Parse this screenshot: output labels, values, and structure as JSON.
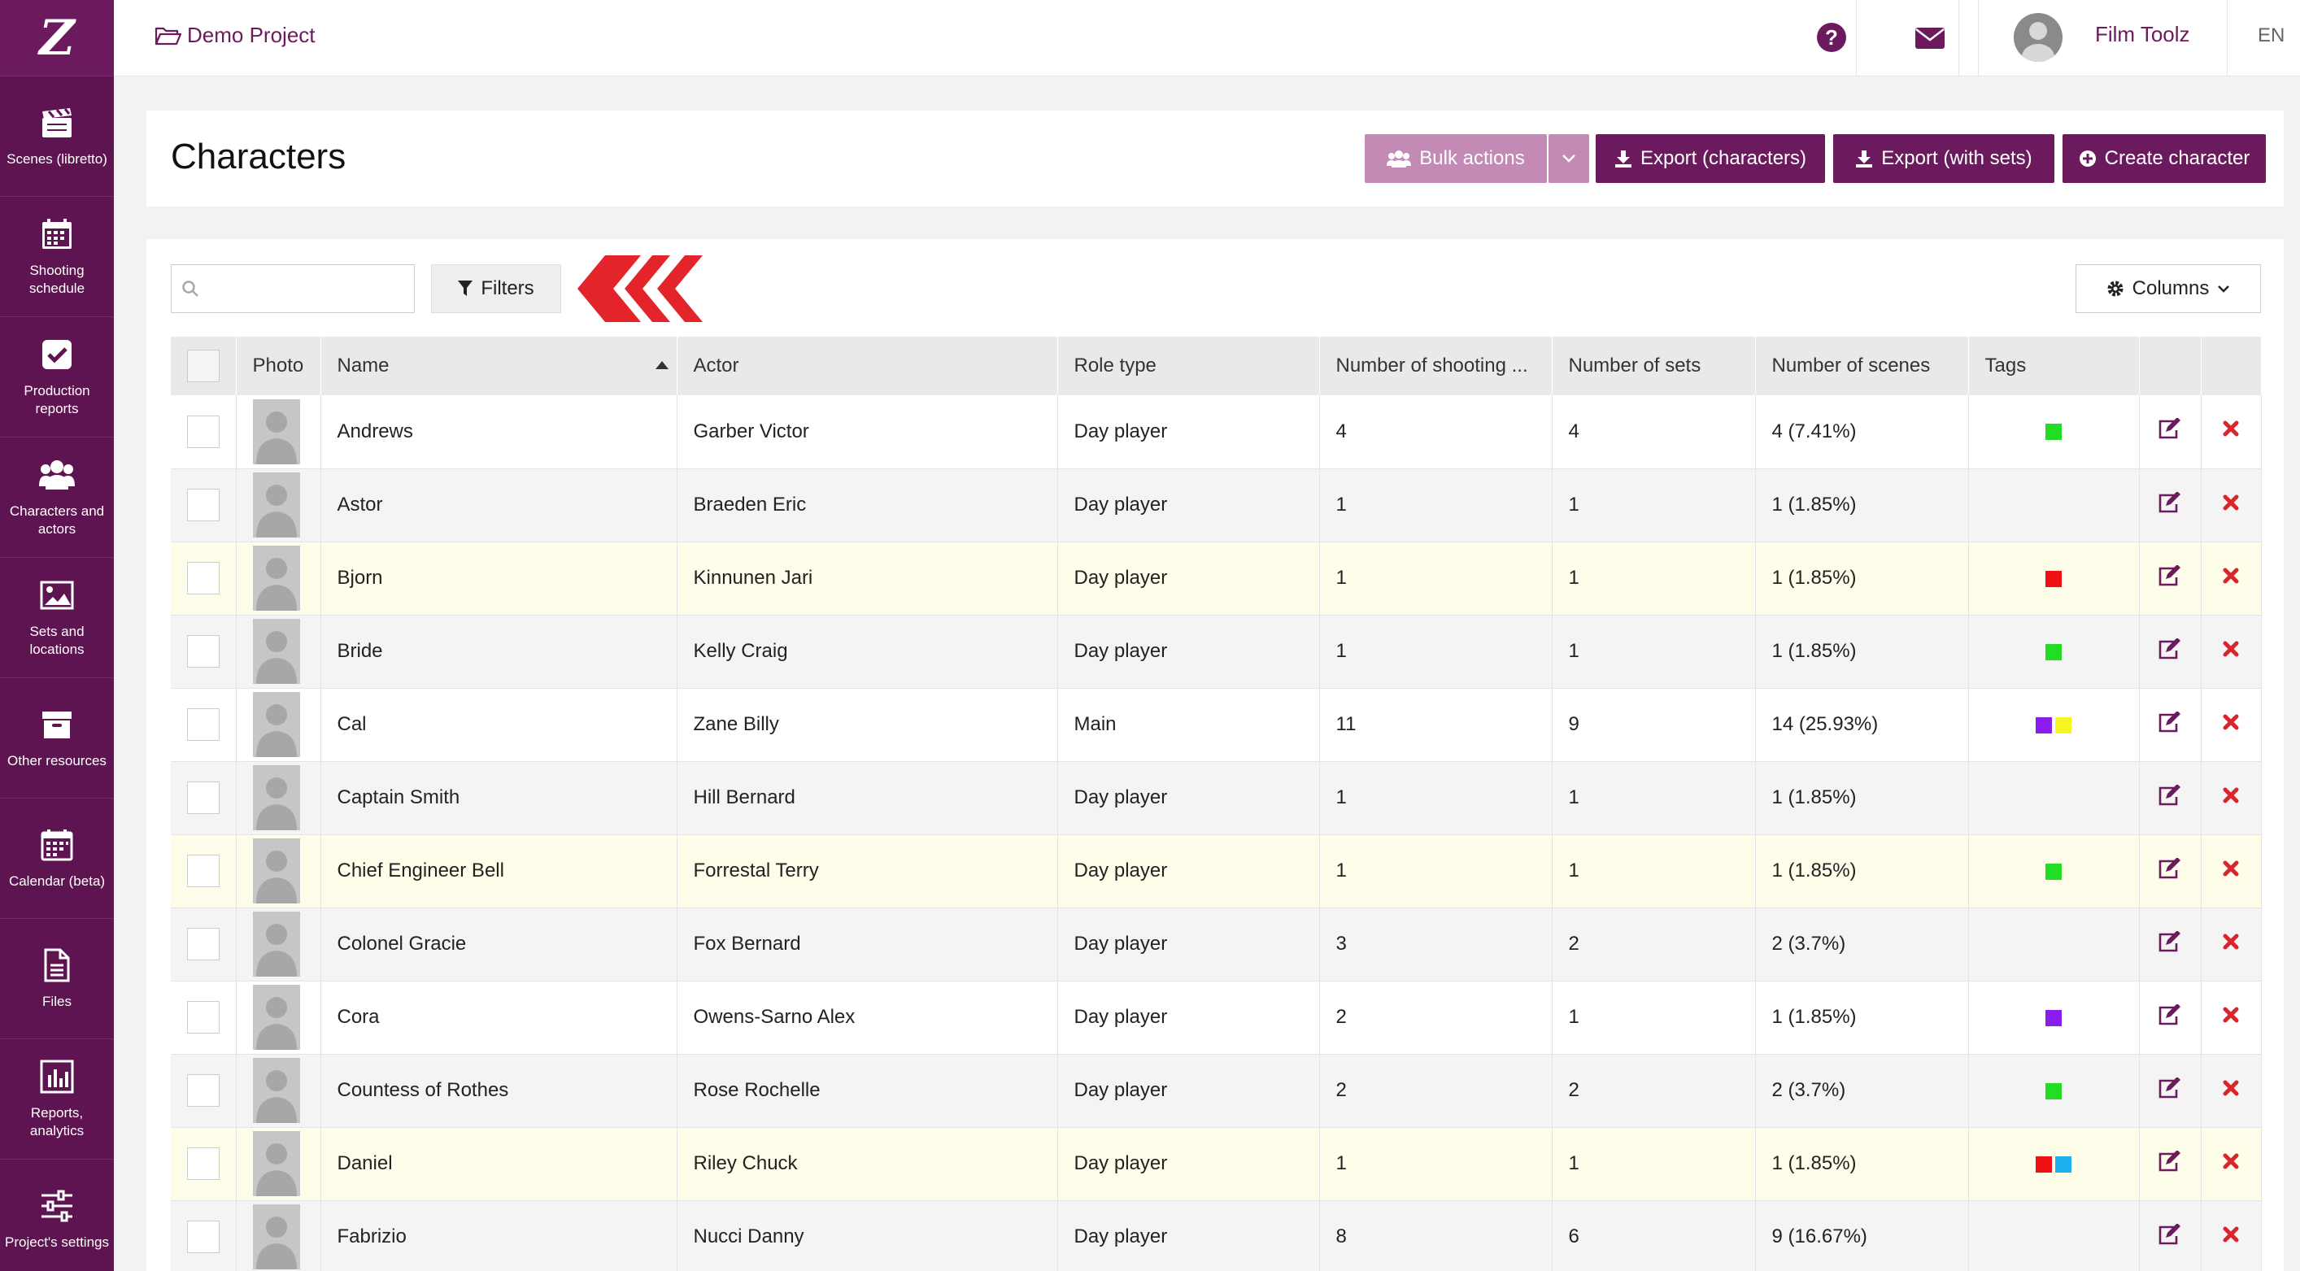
{
  "sidebar": {
    "logo": "Z",
    "items": [
      {
        "label": "Scenes (libretto)",
        "icon": "clapperboard-icon",
        "name": "sidebar-item-scenes"
      },
      {
        "label": "Shooting schedule",
        "icon": "calendar-icon",
        "name": "sidebar-item-shooting-schedule"
      },
      {
        "label": "Production reports",
        "icon": "checkbox-icon",
        "name": "sidebar-item-production-reports"
      },
      {
        "label": "Characters and actors",
        "icon": "users-icon",
        "name": "sidebar-item-characters"
      },
      {
        "label": "Sets and locations",
        "icon": "image-icon",
        "name": "sidebar-item-sets"
      },
      {
        "label": "Other resources",
        "icon": "archive-icon",
        "name": "sidebar-item-other-resources"
      },
      {
        "label": "Calendar (beta)",
        "icon": "calendar-grid-icon",
        "name": "sidebar-item-calendar"
      },
      {
        "label": "Files",
        "icon": "file-icon",
        "name": "sidebar-item-files"
      },
      {
        "label": "Reports, analytics",
        "icon": "bar-chart-icon",
        "name": "sidebar-item-reports"
      },
      {
        "label": "Project's settings",
        "icon": "sliders-icon",
        "name": "sidebar-item-settings"
      }
    ]
  },
  "topbar": {
    "project_name": "Demo Project",
    "user_name": "Film Toolz",
    "language": "EN",
    "help_icon": "question-circle-icon",
    "mail_icon": "envelope-icon"
  },
  "header": {
    "title": "Characters",
    "bulk_actions_label": "Bulk actions",
    "export_characters_label": "Export (characters)",
    "export_with_sets_label": "Export (with sets)",
    "create_character_label": "Create character"
  },
  "toolbar": {
    "search_placeholder": "",
    "filters_label": "Filters",
    "columns_label": "Columns"
  },
  "table": {
    "columns": [
      "Photo",
      "Name",
      "Actor",
      "Role type",
      "Number of shooting ...",
      "Number of sets",
      "Number of scenes",
      "Tags"
    ],
    "sorted_by": "Name",
    "rows": [
      {
        "name": "Andrews",
        "actor": "Garber Victor",
        "role": "Day player",
        "shooting": "4",
        "sets": "4",
        "scenes": "4 (7.41%)",
        "tags": [
          "#22dd22"
        ],
        "highlight": "white"
      },
      {
        "name": "Astor",
        "actor": "Braeden Eric",
        "role": "Day player",
        "shooting": "1",
        "sets": "1",
        "scenes": "1 (1.85%)",
        "tags": [],
        "highlight": "grey"
      },
      {
        "name": "Bjorn",
        "actor": "Kinnunen Jari",
        "role": "Day player",
        "shooting": "1",
        "sets": "1",
        "scenes": "1 (1.85%)",
        "tags": [
          "#ee1111"
        ],
        "highlight": "yellow"
      },
      {
        "name": "Bride",
        "actor": "Kelly Craig",
        "role": "Day player",
        "shooting": "1",
        "sets": "1",
        "scenes": "1 (1.85%)",
        "tags": [
          "#22dd22"
        ],
        "highlight": "grey"
      },
      {
        "name": "Cal",
        "actor": "Zane Billy",
        "role": "Main",
        "shooting": "11",
        "sets": "9",
        "scenes": "14 (25.93%)",
        "tags": [
          "#8a1cf0",
          "#f5f522"
        ],
        "highlight": "white"
      },
      {
        "name": "Captain Smith",
        "actor": "Hill Bernard",
        "role": "Day player",
        "shooting": "1",
        "sets": "1",
        "scenes": "1 (1.85%)",
        "tags": [],
        "highlight": "grey"
      },
      {
        "name": "Chief Engineer Bell",
        "actor": "Forrestal Terry",
        "role": "Day player",
        "shooting": "1",
        "sets": "1",
        "scenes": "1 (1.85%)",
        "tags": [
          "#22dd22"
        ],
        "highlight": "yellow"
      },
      {
        "name": "Colonel Gracie",
        "actor": "Fox Bernard",
        "role": "Day player",
        "shooting": "3",
        "sets": "2",
        "scenes": "2 (3.7%)",
        "tags": [],
        "highlight": "grey"
      },
      {
        "name": "Cora",
        "actor": "Owens-Sarno Alex",
        "role": "Day player",
        "shooting": "2",
        "sets": "1",
        "scenes": "1 (1.85%)",
        "tags": [
          "#8a1cf0"
        ],
        "highlight": "white"
      },
      {
        "name": "Countess of Rothes",
        "actor": "Rose Rochelle",
        "role": "Day player",
        "shooting": "2",
        "sets": "2",
        "scenes": "2 (3.7%)",
        "tags": [
          "#22dd22"
        ],
        "highlight": "grey"
      },
      {
        "name": "Daniel",
        "actor": "Riley Chuck",
        "role": "Day player",
        "shooting": "1",
        "sets": "1",
        "scenes": "1 (1.85%)",
        "tags": [
          "#ee1111",
          "#1cb0f0"
        ],
        "highlight": "yellow"
      },
      {
        "name": "Fabrizio",
        "actor": "Nucci Danny",
        "role": "Day player",
        "shooting": "8",
        "sets": "6",
        "scenes": "9 (16.67%)",
        "tags": [],
        "highlight": "grey"
      }
    ]
  },
  "colors": {
    "brand": "#6b1b5d",
    "sidebar": "#5e1450",
    "bulk_button": "#c28ab4",
    "delete_red": "#d9262c",
    "collapse_arrow_red": "#e3242b"
  }
}
